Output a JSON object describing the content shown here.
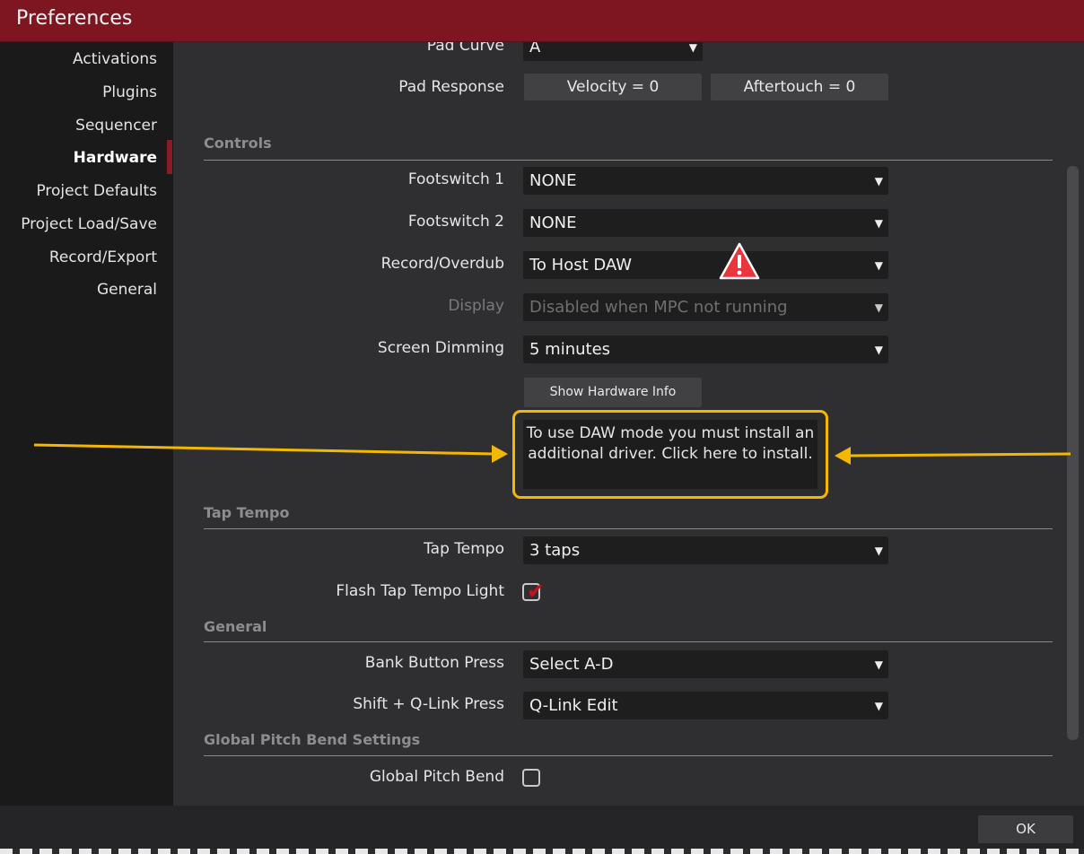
{
  "window": {
    "title": "Preferences"
  },
  "sidebar": {
    "items": [
      {
        "label": "Activations"
      },
      {
        "label": "Plugins"
      },
      {
        "label": "Sequencer"
      },
      {
        "label": "Hardware",
        "active": true
      },
      {
        "label": "Project Defaults"
      },
      {
        "label": "Project Load/Save"
      },
      {
        "label": "Record/Export"
      },
      {
        "label": "General"
      }
    ]
  },
  "pads": {
    "pad_curve": {
      "label": "Pad Curve",
      "value": "A"
    },
    "pad_response": {
      "label": "Pad Response",
      "velocity_button": "Velocity = 0",
      "aftertouch_button": "Aftertouch = 0"
    }
  },
  "controls": {
    "section_title": "Controls",
    "footswitch1": {
      "label": "Footswitch 1",
      "value": "NONE"
    },
    "footswitch2": {
      "label": "Footswitch 2",
      "value": "NONE"
    },
    "record_overdub": {
      "label": "Record/Overdub",
      "value": "To Host DAW"
    },
    "display": {
      "label": "Display",
      "value": "Disabled when MPC not running"
    },
    "screen_dimming": {
      "label": "Screen Dimming",
      "value": "5 minutes"
    },
    "show_hardware_info_button": "Show Hardware Info",
    "daw_tooltip": "To use DAW mode you must install an additional driver. Click here to install."
  },
  "tap_tempo": {
    "section_title": "Tap Tempo",
    "tap_tempo": {
      "label": "Tap Tempo",
      "value": "3 taps"
    },
    "flash_light": {
      "label": "Flash Tap Tempo Light",
      "checked": true
    }
  },
  "general": {
    "section_title": "General",
    "bank_button": {
      "label": "Bank Button Press",
      "value": "Select A-D"
    },
    "shift_qlink": {
      "label": "Shift + Q-Link Press",
      "value": "Q-Link Edit"
    }
  },
  "pitch_bend": {
    "section_title": "Global Pitch Bend Settings",
    "global_pitch_bend": {
      "label": "Global Pitch Bend",
      "checked": false
    }
  },
  "footer": {
    "ok_label": "OK"
  },
  "colors": {
    "titlebar": "#7e1622",
    "accent": "#8d1a26",
    "highlight": "#f5b800",
    "warning": "#e8363c"
  }
}
